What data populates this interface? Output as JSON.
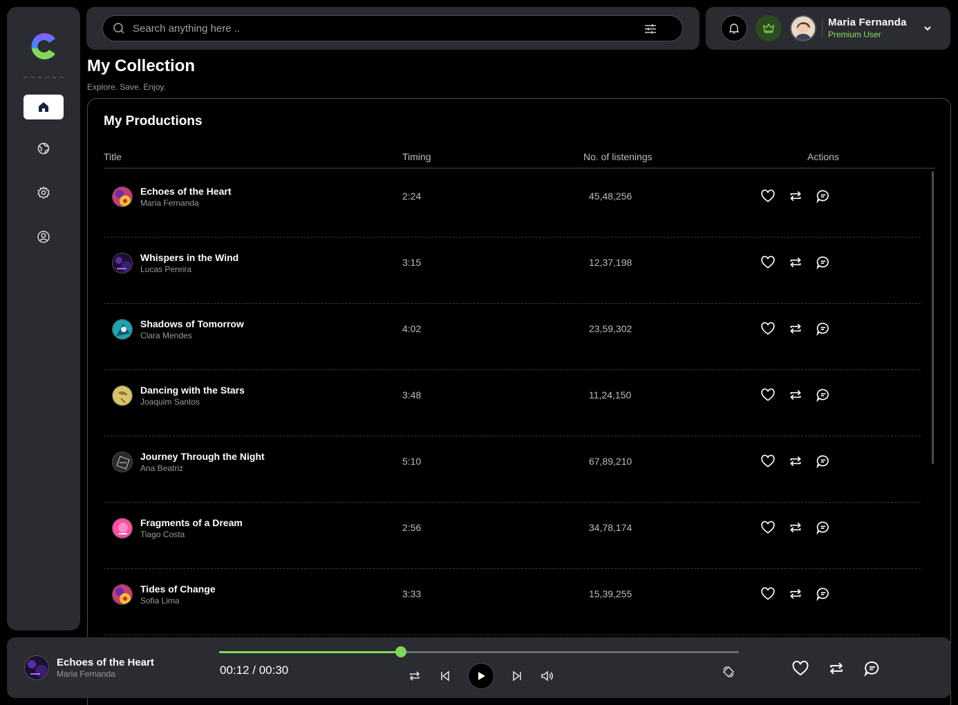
{
  "search": {
    "placeholder": "Search anything here .."
  },
  "user": {
    "name": "Maria Fernanda",
    "tier": "Premium User"
  },
  "page": {
    "title": "My Collection",
    "subtitle": "Explore. Save. Enjoy."
  },
  "section": {
    "title": "My Productions"
  },
  "table": {
    "headers": [
      "Title",
      "Timing",
      "No. of listenings",
      "Actions"
    ],
    "rows": [
      {
        "title": "Echoes of the Heart",
        "artist": "Maria Fernanda",
        "timing": "2:24",
        "listens": "45,48,256"
      },
      {
        "title": "Whispers in the Wind",
        "artist": "Lucas Pereira",
        "timing": "3:15",
        "listens": "12,37,198"
      },
      {
        "title": "Shadows of Tomorrow",
        "artist": "Clara Mendes",
        "timing": "4:02",
        "listens": "23,59,302"
      },
      {
        "title": "Dancing with the Stars",
        "artist": "Joaquim Santos",
        "timing": "3:48",
        "listens": "11,24,150"
      },
      {
        "title": "Journey Through the Night",
        "artist": "Ana Beatriz",
        "timing": "5:10",
        "listens": "67,89,210"
      },
      {
        "title": "Fragments of a Dream",
        "artist": "Tiago Costa",
        "timing": "2:56",
        "listens": "34,78,174"
      },
      {
        "title": "Tides of Change",
        "artist": "Sofia Lima",
        "timing": "3:33",
        "listens": "15,39,255"
      }
    ]
  },
  "player": {
    "title": "Echoes of the Heart",
    "artist": "Maria Fernanda",
    "time": "00:12 / 00:30",
    "progress": 0.35
  },
  "colors": {
    "accent": "#7ed957",
    "panel": "#2a2c31",
    "background": "#000000"
  },
  "icons": {
    "nav": [
      "home-icon",
      "globe-icon",
      "settings-icon",
      "profile-icon"
    ],
    "row_actions": [
      "heart-icon",
      "repeat-icon",
      "comment-icon"
    ],
    "player_controls": [
      "repeat-icon",
      "previous-icon",
      "play-icon",
      "next-icon",
      "volume-icon",
      "rotate-icon"
    ]
  }
}
